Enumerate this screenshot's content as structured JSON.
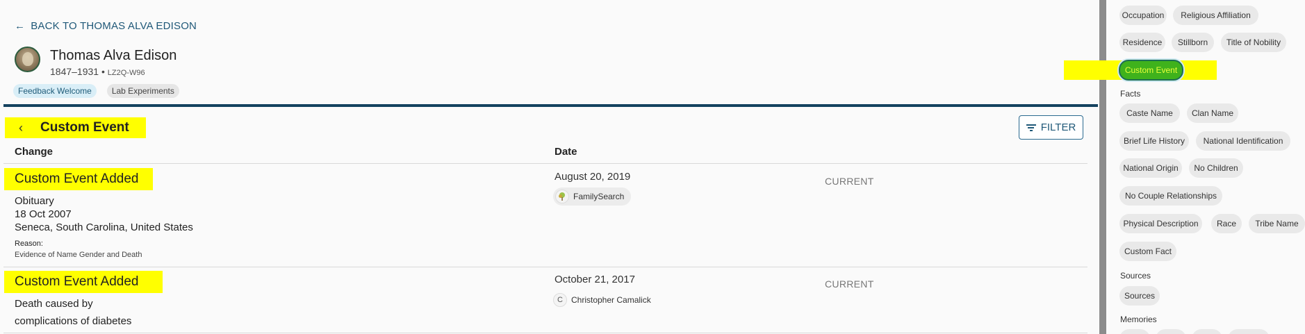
{
  "header": {
    "back_label": "BACK TO THOMAS ALVA EDISON",
    "person_name": "Thomas Alva Edison",
    "person_lifespan": "1847–1931",
    "person_separator": " • ",
    "person_id": "LZ2Q-W96",
    "tags": [
      "Feedback Welcome",
      "Lab Experiments"
    ]
  },
  "section": {
    "title": "Custom Event",
    "filter_label": "FILTER"
  },
  "columns": {
    "change": "Change",
    "date": "Date"
  },
  "rows": [
    {
      "title": "Custom Event Added",
      "lines": [
        "Obituary",
        "18 Oct 2007",
        "Seneca, South Carolina, United States"
      ],
      "reason_label": "Reason:",
      "reason": "Evidence of Name Gender and Death",
      "date": "August 20, 2019",
      "contributor": "FamilySearch",
      "contributor_icon": "tree-icon",
      "status": "CURRENT"
    },
    {
      "title": "Custom Event Added",
      "lines": [
        "Death caused by",
        "complications of diabetes"
      ],
      "date": "October 21, 2017",
      "contributor": "Christopher Camalick",
      "contributor_initial": "C",
      "status": "CURRENT"
    }
  ],
  "sidebar": {
    "events_chips": [
      "Occupation",
      "Religious Affiliation",
      "Residence",
      "Stillborn",
      "Title of Nobility"
    ],
    "active_chip": "Custom Event",
    "facts_label": "Facts",
    "facts_chips": [
      "Caste Name",
      "Clan Name",
      "Brief Life History",
      "National Identification",
      "National Origin",
      "No Children",
      "No Couple Relationships",
      "Physical Description",
      "Race",
      "Tribe Name",
      "Custom Fact"
    ],
    "sources_label": "Sources",
    "sources_chips": [
      "Sources"
    ],
    "memories_label": "Memories"
  },
  "colors": {
    "highlight": "#ffff00",
    "accent": "#14425f",
    "link": "#1f5878",
    "active_chip_bg": "#3fb21c",
    "active_chip_text": "#e8ff3a"
  }
}
